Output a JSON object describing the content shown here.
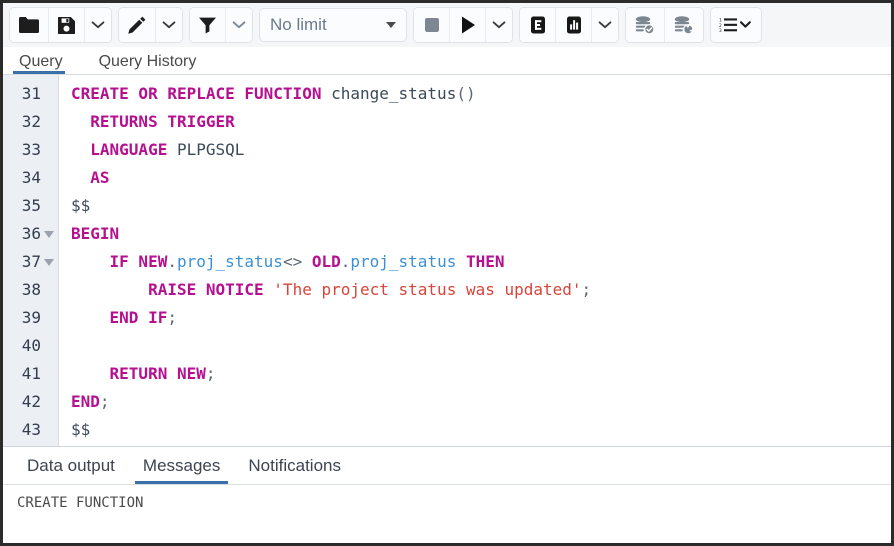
{
  "toolbar": {
    "groups": [
      {
        "name": "file-group",
        "buttons": [
          {
            "name": "open-file-button",
            "icon": "folder-icon",
            "title": "Open File",
            "disabled": false
          },
          {
            "name": "save-file-button",
            "icon": "save-icon",
            "title": "Save File",
            "disabled": false
          },
          {
            "name": "save-dropdown-button",
            "icon": "chevron-down-icon",
            "title": "Save options",
            "disabled": false
          }
        ]
      },
      {
        "name": "edit-group",
        "buttons": [
          {
            "name": "edit-button",
            "icon": "pencil-icon",
            "title": "Edit",
            "disabled": false
          },
          {
            "name": "edit-dropdown-button",
            "icon": "chevron-down-icon",
            "title": "Edit options",
            "disabled": false
          }
        ]
      },
      {
        "name": "filter-group",
        "buttons": [
          {
            "name": "filter-button",
            "icon": "funnel-icon",
            "title": "Filter",
            "disabled": false
          },
          {
            "name": "filter-dropdown-button",
            "icon": "chevron-down-icon",
            "title": "Filter options",
            "disabled": false
          }
        ]
      },
      {
        "name": "execute-group",
        "buttons": [
          {
            "name": "stop-button",
            "icon": "stop-square-icon",
            "title": "Stop",
            "disabled": true
          },
          {
            "name": "execute-button",
            "icon": "play-triangle-icon",
            "title": "Execute/Refresh",
            "disabled": false
          },
          {
            "name": "execute-dropdown-button",
            "icon": "chevron-down-icon",
            "title": "Execute options",
            "disabled": false
          }
        ]
      },
      {
        "name": "explain-group",
        "buttons": [
          {
            "name": "explain-button",
            "icon": "explain-e-icon",
            "title": "Explain",
            "disabled": false
          },
          {
            "name": "explain-analyze-button",
            "icon": "bar-chart-icon",
            "title": "Explain Analyze",
            "disabled": false
          },
          {
            "name": "explain-dropdown-button",
            "icon": "chevron-down-icon",
            "title": "Explain options",
            "disabled": false
          }
        ]
      },
      {
        "name": "transaction-group",
        "buttons": [
          {
            "name": "commit-button",
            "icon": "database-check-icon",
            "title": "Commit",
            "disabled": true
          },
          {
            "name": "rollback-button",
            "icon": "database-rollback-icon",
            "title": "Rollback",
            "disabled": true
          }
        ]
      },
      {
        "name": "macros-group",
        "buttons": [
          {
            "name": "macros-button",
            "icon": "numbered-list-chevron-icon",
            "title": "Macros",
            "disabled": false
          }
        ]
      }
    ],
    "row_limit": {
      "label": "No limit",
      "name": "row-limit-select"
    }
  },
  "editor_tabs": [
    {
      "label": "Query",
      "active": true
    },
    {
      "label": "Query History",
      "active": false
    }
  ],
  "editor": {
    "lines": [
      {
        "number": "31",
        "fold": false,
        "tokens": [
          {
            "t": "CREATE OR REPLACE FUNCTION ",
            "c": "kw"
          },
          {
            "t": "change_status",
            "c": "id"
          },
          {
            "t": "()",
            "c": "pun"
          }
        ]
      },
      {
        "number": "32",
        "fold": false,
        "tokens": [
          {
            "t": "  ",
            "c": "plain"
          },
          {
            "t": "RETURNS TRIGGER",
            "c": "kw"
          }
        ]
      },
      {
        "number": "33",
        "fold": false,
        "tokens": [
          {
            "t": "  ",
            "c": "plain"
          },
          {
            "t": "LANGUAGE ",
            "c": "kw"
          },
          {
            "t": "PLPGSQL",
            "c": "id"
          }
        ]
      },
      {
        "number": "34",
        "fold": false,
        "tokens": [
          {
            "t": "  ",
            "c": "plain"
          },
          {
            "t": "AS",
            "c": "kw"
          }
        ]
      },
      {
        "number": "35",
        "fold": false,
        "tokens": [
          {
            "t": "$$",
            "c": "plain"
          }
        ]
      },
      {
        "number": "36",
        "fold": true,
        "tokens": [
          {
            "t": "BEGIN",
            "c": "kw"
          }
        ]
      },
      {
        "number": "37",
        "fold": true,
        "tokens": [
          {
            "t": "    ",
            "c": "plain"
          },
          {
            "t": "IF NEW",
            "c": "kw"
          },
          {
            "t": ".",
            "c": "pun"
          },
          {
            "t": "proj_status",
            "c": "col"
          },
          {
            "t": "<>",
            "c": "pun"
          },
          {
            "t": " OLD",
            "c": "kw"
          },
          {
            "t": ".",
            "c": "pun"
          },
          {
            "t": "proj_status",
            "c": "col"
          },
          {
            "t": " THEN",
            "c": "kw"
          }
        ]
      },
      {
        "number": "38",
        "fold": false,
        "tokens": [
          {
            "t": "        ",
            "c": "plain"
          },
          {
            "t": "RAISE NOTICE ",
            "c": "kw"
          },
          {
            "t": "'The project status was updated'",
            "c": "str"
          },
          {
            "t": ";",
            "c": "pun"
          }
        ]
      },
      {
        "number": "39",
        "fold": false,
        "tokens": [
          {
            "t": "    ",
            "c": "plain"
          },
          {
            "t": "END IF",
            "c": "kw"
          },
          {
            "t": ";",
            "c": "pun"
          }
        ]
      },
      {
        "number": "40",
        "fold": false,
        "tokens": []
      },
      {
        "number": "41",
        "fold": false,
        "tokens": [
          {
            "t": "    ",
            "c": "plain"
          },
          {
            "t": "RETURN NEW",
            "c": "kw"
          },
          {
            "t": ";",
            "c": "pun"
          }
        ]
      },
      {
        "number": "42",
        "fold": false,
        "tokens": [
          {
            "t": "END",
            "c": "kw"
          },
          {
            "t": ";",
            "c": "pun"
          }
        ]
      },
      {
        "number": "43",
        "fold": false,
        "tokens": [
          {
            "t": "$$",
            "c": "plain"
          }
        ]
      }
    ]
  },
  "output_tabs": [
    {
      "label": "Data output",
      "active": false
    },
    {
      "label": "Messages",
      "active": true
    },
    {
      "label": "Notifications",
      "active": false
    }
  ],
  "messages": {
    "text": "CREATE FUNCTION"
  },
  "colors": {
    "accent": "#3b6fa8",
    "keyword": "#b5108f",
    "string": "#d8453a",
    "column": "#3d8fd6",
    "identifier": "#3b4a5a",
    "gutter_bg": "#eceff4",
    "toolbar_bg": "#f4f6f8",
    "frame_border": "#2b2b2b"
  }
}
